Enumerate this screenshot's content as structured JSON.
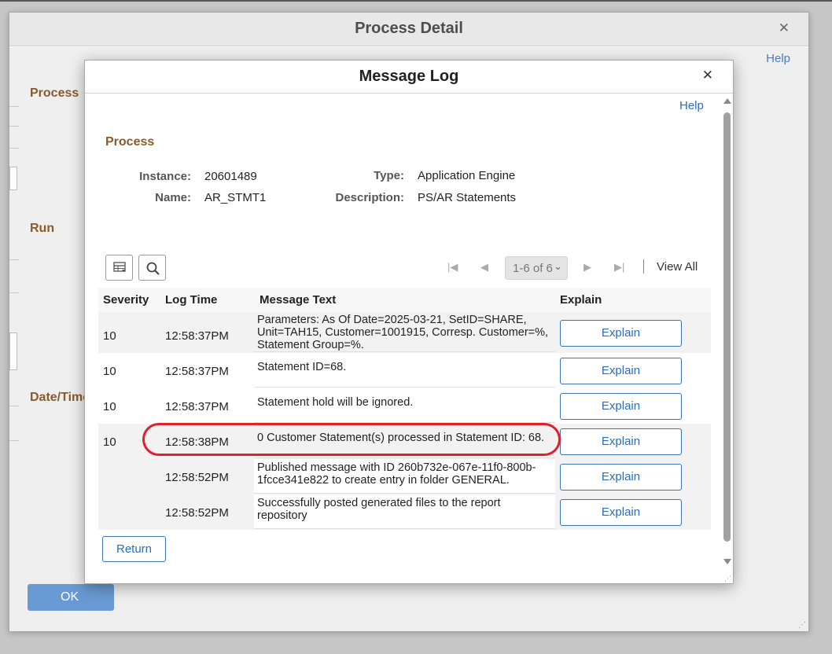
{
  "outer_dialog": {
    "title": "Process Detail",
    "close_glyph": "✕",
    "help": "Help",
    "labels": {
      "process": "Process",
      "run": "Run",
      "datetime": "Date/Time"
    },
    "ok": "OK"
  },
  "message_log": {
    "title": "Message Log",
    "close_glyph": "✕",
    "help": "Help",
    "section": "Process",
    "fields": {
      "instance_label": "Instance:",
      "instance_value": "20601489",
      "name_label": "Name:",
      "name_value": "AR_STMT1",
      "type_label": "Type:",
      "type_value": "Application Engine",
      "description_label": "Description:",
      "description_value": "PS/AR Statements"
    },
    "toolbar": {
      "grid_icon": "personalize-grid-icon",
      "search_icon": "search-icon"
    },
    "pagination": {
      "range": "1-6 of 6",
      "view_all": "View All"
    },
    "columns": {
      "severity": "Severity",
      "log_time": "Log Time",
      "message_text": "Message Text",
      "explain": "Explain"
    },
    "rows": [
      {
        "severity": "10",
        "log_time": "12:58:37PM",
        "message_lines": [
          "Parameters: As Of Date=2025-03-21, SetID=SHARE,",
          "Unit=TAH15, Customer=1001915, Corresp. Customer=%,",
          "Statement Group=%."
        ],
        "explain": "Explain"
      },
      {
        "severity": "10",
        "log_time": "12:58:37PM",
        "message_lines": [
          "Statement ID=68."
        ],
        "explain": "Explain"
      },
      {
        "severity": "10",
        "log_time": "12:58:37PM",
        "message_lines": [
          "Statement hold will be ignored."
        ],
        "explain": "Explain"
      },
      {
        "severity": "10",
        "log_time": "12:58:38PM",
        "message_lines": [
          "0 Customer Statement(s) processed in Statement ID: 68."
        ],
        "explain": "Explain"
      },
      {
        "severity": "",
        "log_time": "12:58:52PM",
        "message_lines": [
          "Published message with ID 260b732e-067e-11f0-800b-",
          "1fcce341e822 to create entry in folder GENERAL."
        ],
        "explain": "Explain"
      },
      {
        "severity": "",
        "log_time": "12:58:52PM",
        "message_lines": [
          "Successfully posted generated files to the report",
          "repository"
        ],
        "explain": "Explain"
      }
    ],
    "return": "Return",
    "highlight_color": "#e0202a"
  }
}
